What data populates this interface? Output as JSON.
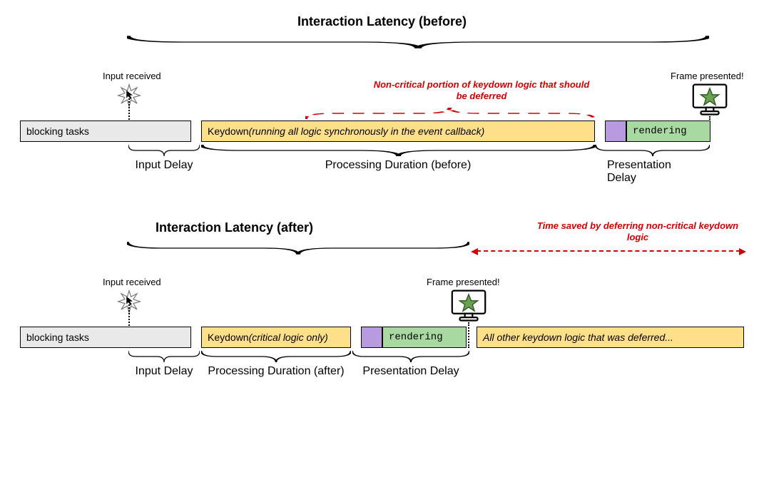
{
  "before": {
    "title": "Interaction Latency (before)",
    "inputReceived": "Input received",
    "framePresented": "Frame presented!",
    "warn": "Non-critical portion of keydown logic that should be deferred",
    "blocks": {
      "blocking": "blocking tasks",
      "keydownPrefix": "Keydown ",
      "keydownItalic": "(running all logic synchronously in the event callback)",
      "rendering": "rendering"
    },
    "braces": {
      "inputDelay": "Input Delay",
      "processing": "Processing Duration (before)",
      "presentation": "Presentation Delay"
    }
  },
  "after": {
    "title": "Interaction Latency (after)",
    "inputReceived": "Input received",
    "framePresented": "Frame presented!",
    "warn": "Time saved by deferring non-critical keydown logic",
    "blocks": {
      "blocking": "blocking tasks",
      "keydownPrefix": "Keydown ",
      "keydownItalic": "(critical logic only)",
      "rendering": "rendering",
      "deferredItalic": "All other keydown logic that was deferred..."
    },
    "braces": {
      "inputDelay": "Input Delay",
      "processing": "Processing Duration (after)",
      "presentation": "Presentation Delay"
    }
  }
}
